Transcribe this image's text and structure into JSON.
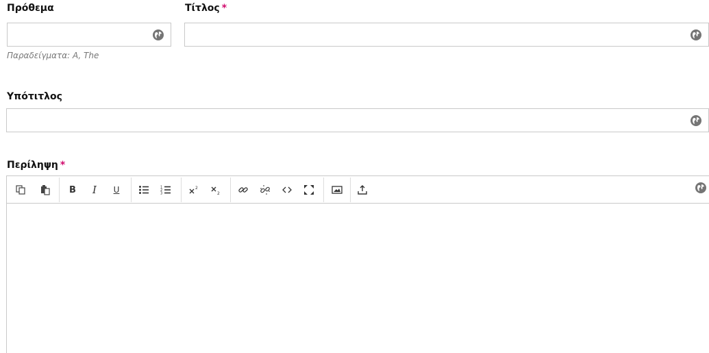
{
  "fields": {
    "prefix": {
      "label": "Πρόθεμα",
      "value": "",
      "hint": "Παραδείγματα: A, The"
    },
    "title": {
      "label": "Τίτλος",
      "required_mark": "*",
      "value": ""
    },
    "subtitle": {
      "label": "Υπότιτλος",
      "value": ""
    },
    "abstract": {
      "label": "Περίληψη",
      "required_mark": "*",
      "value": ""
    }
  },
  "toolbar": {
    "buttons": [
      "copy-icon",
      "paste-icon",
      "bold-icon",
      "italic-icon",
      "underline-icon",
      "bullet-list-icon",
      "numbered-list-icon",
      "superscript-icon",
      "subscript-icon",
      "link-icon",
      "unlink-icon",
      "code-icon",
      "fullscreen-icon",
      "image-icon",
      "upload-icon"
    ],
    "bold_glyph": "B",
    "italic_glyph": "I",
    "underline_glyph": "U"
  },
  "colors": {
    "required": "#d00a6c",
    "border": "#c8c8c8",
    "globe": "#757575"
  },
  "icons": {
    "language": "globe-icon"
  }
}
